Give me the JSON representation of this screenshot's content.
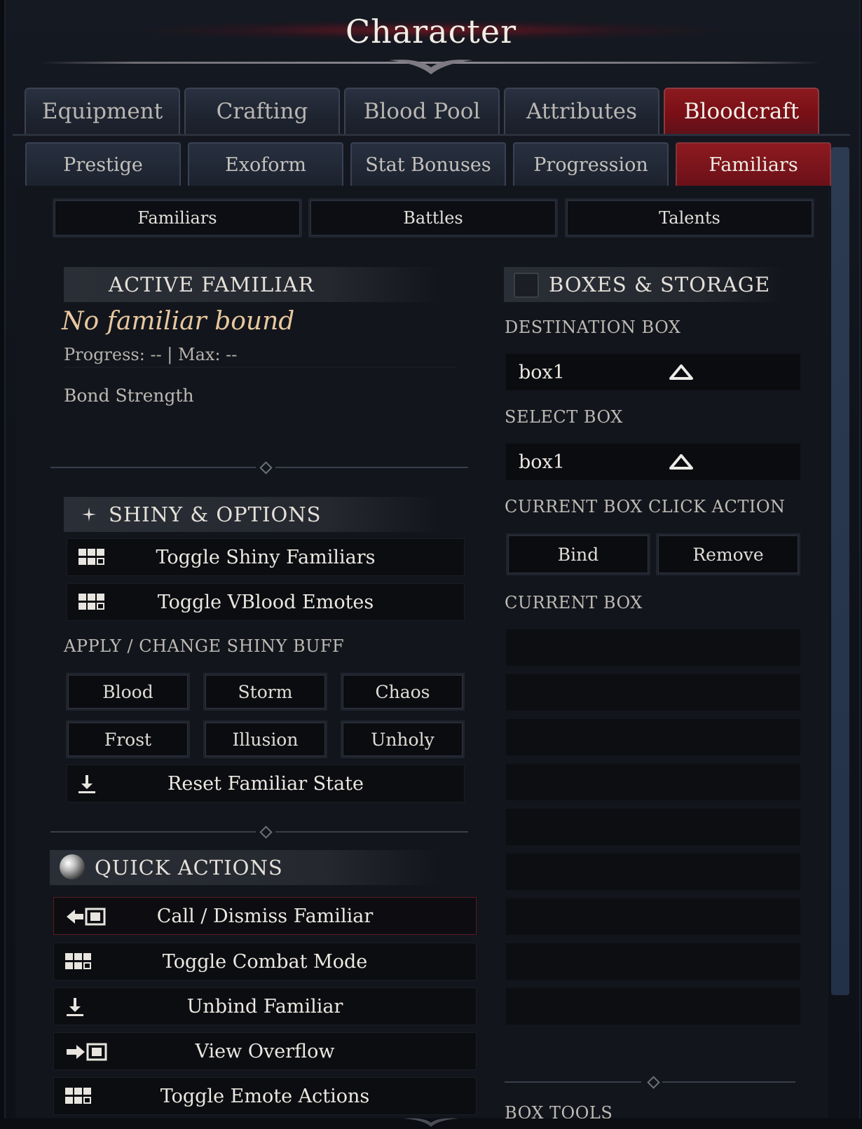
{
  "window": {
    "title": "Character"
  },
  "main_tabs": [
    {
      "label": "Equipment",
      "active": false
    },
    {
      "label": "Crafting",
      "active": false
    },
    {
      "label": "Blood Pool",
      "active": false
    },
    {
      "label": "Attributes",
      "active": false
    },
    {
      "label": "Bloodcraft",
      "active": true
    }
  ],
  "sub_tabs": [
    {
      "label": "Prestige",
      "active": false
    },
    {
      "label": "Exoform",
      "active": false
    },
    {
      "label": "Stat Bonuses",
      "active": false
    },
    {
      "label": "Progression",
      "active": false
    },
    {
      "label": "Familiars",
      "active": true
    }
  ],
  "third_tabs": [
    {
      "label": "Familiars"
    },
    {
      "label": "Battles"
    },
    {
      "label": "Talents"
    }
  ],
  "active_familiar": {
    "heading": "ACTIVE FAMILIAR",
    "name": "No familiar bound",
    "progress": "Progress: -- | Max: --",
    "bond_label": "Bond Strength"
  },
  "shiny_options": {
    "heading": "SHINY & OPTIONS",
    "toggle_shiny": "Toggle Shiny Familiars",
    "toggle_vblood": "Toggle VBlood Emotes",
    "buff_label": "APPLY / CHANGE SHINY BUFF",
    "buffs": [
      "Blood",
      "Storm",
      "Chaos",
      "Frost",
      "Illusion",
      "Unholy"
    ],
    "reset": "Reset Familiar State"
  },
  "quick_actions": {
    "heading": "QUICK ACTIONS",
    "items": [
      {
        "label": "Call / Dismiss Familiar",
        "icon": "call-dismiss-icon"
      },
      {
        "label": "Toggle Combat Mode",
        "icon": "grid-icon"
      },
      {
        "label": "Unbind Familiar",
        "icon": "download-icon"
      },
      {
        "label": "View Overflow",
        "icon": "overflow-icon"
      },
      {
        "label": "Toggle Emote Actions",
        "icon": "grid-icon"
      }
    ]
  },
  "boxes": {
    "heading": "BOXES & STORAGE",
    "destination_label": "DESTINATION BOX",
    "destination_value": "box1",
    "select_label": "SELECT BOX",
    "select_value": "box1",
    "click_action_label": "CURRENT BOX CLICK ACTION",
    "bind_label": "Bind",
    "remove_label": "Remove",
    "current_box_label": "CURRENT BOX",
    "box_tools_label": "BOX TOOLS"
  },
  "colors": {
    "accent_red": "#7a0f16",
    "panel_bg": "#12151c",
    "text": "#d9d6d0"
  }
}
